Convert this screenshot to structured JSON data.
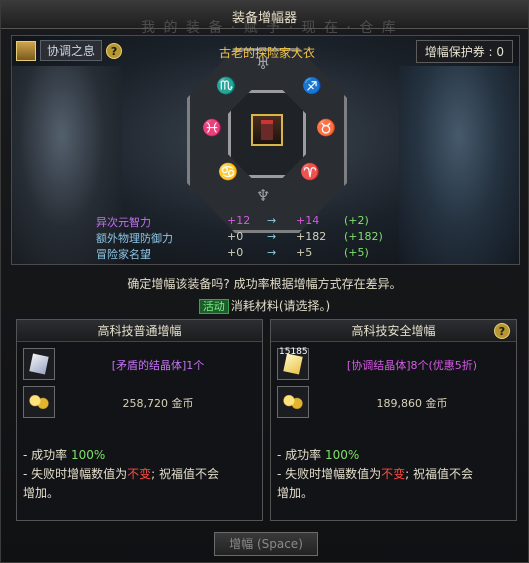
{
  "window": {
    "title": "装备增幅器",
    "ghost_text": "我  的  装  备  ·  赋  予  ·  现  在  ·  仓  库"
  },
  "header": {
    "harmony_label": "协调之息",
    "help_glyph": "?",
    "item_name": "古老的探险家大衣",
    "protect_label": "增幅保护券 : 0"
  },
  "stats": [
    {
      "name": "异次元智力",
      "current": "+12",
      "arrow": "→",
      "next": "+14",
      "delta": "(+2)",
      "name_color": "#c472f2"
    },
    {
      "name": "额外物理防御力",
      "current": "+0",
      "arrow": "→",
      "next": "+182",
      "delta": "(+182)",
      "name_color": "#8ec6e6"
    },
    {
      "name": "冒险家名望",
      "current": "+0",
      "arrow": "→",
      "next": "+5",
      "delta": "(+5)",
      "name_color": "#8ec6e6"
    }
  ],
  "confirm_text": "确定增幅该装备吗? 成功率根据增幅方式存在差异。",
  "consume": {
    "tag": "活动",
    "text": "消耗材料(请选择。)"
  },
  "panels": {
    "left": {
      "title": "高科技普通增幅",
      "material": "[矛盾的结晶体]1个",
      "gold": "258,720 金币",
      "rate_prefix": "- 成功率 ",
      "rate_value": "100%",
      "fail_prefix": "- 失败时增幅数值为",
      "fail_red": "不变",
      "fail_suffix": "; 祝福值不会",
      "fail_line2": "增加。"
    },
    "right": {
      "title": "高科技安全增幅",
      "help_glyph": "?",
      "material_count": "15185",
      "material": "[协调结晶体]8个(优惠5折)",
      "gold": "189,860 金币",
      "rate_prefix": "- 成功率 ",
      "rate_value": "100%",
      "fail_prefix": "- 失败时增幅数值为",
      "fail_red": "不变",
      "fail_suffix": "; 祝福值不会",
      "fail_line2": "增加。"
    }
  },
  "enhance_button": "增幅 (Space)",
  "icons": {
    "harmony": "harmony-icon",
    "item": "coat-icon",
    "crystal": "crystal-icon",
    "gold": "gold-coins-icon"
  }
}
